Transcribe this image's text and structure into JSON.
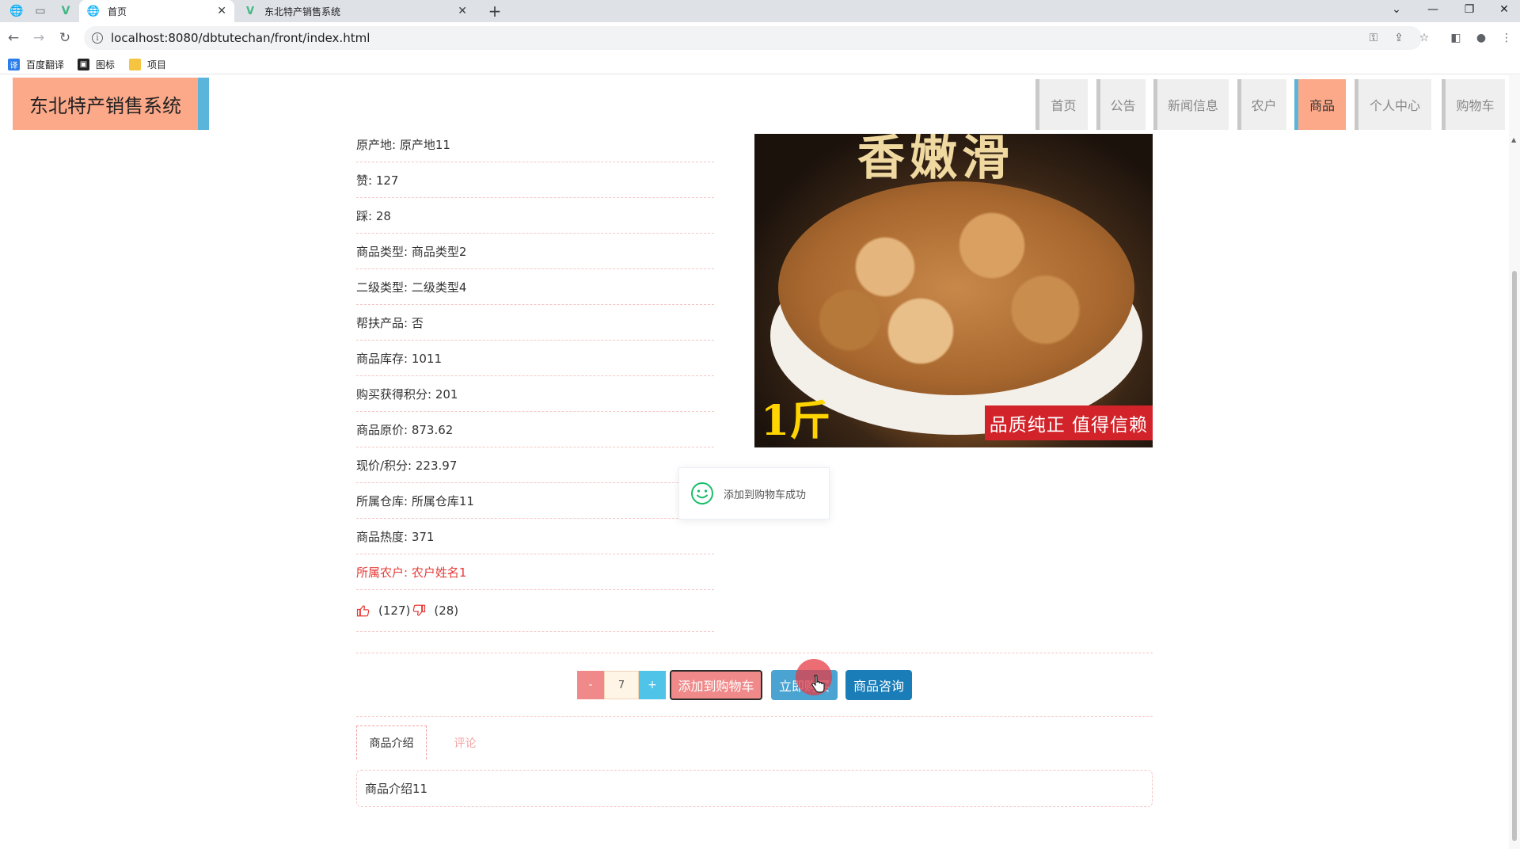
{
  "browser": {
    "tabs": [
      {
        "title": "首页",
        "active": true
      },
      {
        "title": "东北特产销售系统",
        "active": false
      }
    ],
    "url": "localhost:8080/dbtutechan/front/index.html",
    "bookmarks": [
      "百度翻译",
      "图标",
      "项目"
    ]
  },
  "site": {
    "logo": "东北特产销售系统",
    "nav": [
      "首页",
      "公告",
      "新闻信息",
      "农户",
      "商品",
      "个人中心",
      "购物车"
    ],
    "nav_active": "商品"
  },
  "product": {
    "fields": [
      {
        "label": "原产地",
        "value": "原产地11"
      },
      {
        "label": "赞",
        "value": "127"
      },
      {
        "label": "踩",
        "value": "28"
      },
      {
        "label": "商品类型",
        "value": "商品类型2"
      },
      {
        "label": "二级类型",
        "value": "二级类型4"
      },
      {
        "label": "帮扶产品",
        "value": "否"
      },
      {
        "label": "商品库存",
        "value": "1011"
      },
      {
        "label": "购买获得积分",
        "value": "201"
      },
      {
        "label": "商品原价",
        "value": "873.62"
      },
      {
        "label": "现价/积分",
        "value": "223.97"
      },
      {
        "label": "所属仓库",
        "value": "所属仓库11"
      },
      {
        "label": "商品热度",
        "value": "371"
      },
      {
        "label": "所属农户",
        "value": "农户姓名1"
      }
    ],
    "field_lines": [
      "原产地: 原产地11",
      "赞: 127",
      "踩: 28",
      "商品类型: 商品类型2",
      "二级类型: 二级类型4",
      "帮扶产品: 否",
      "商品库存: 1011",
      "购买获得积分: 201",
      "商品原价: 873.62",
      "现价/积分: 223.97",
      "所属仓库: 所属仓库11",
      "商品热度: 371",
      "所属农户: 农户姓名1"
    ],
    "like_text": "(127)",
    "dislike_text": "(28)",
    "image": {
      "title_text": "香嫩滑",
      "weight_text": "1斤",
      "banner_text": "品质纯正 值得信赖"
    },
    "quantity": {
      "minus": "-",
      "value": "7",
      "plus": "+"
    },
    "buttons": {
      "add_to_cart": "添加到购物车",
      "buy_now": "立即购买",
      "consult": "商品咨询"
    },
    "tabs": [
      "商品介绍",
      "评论"
    ],
    "description": "商品介绍11"
  },
  "toast": {
    "message": "添加到购物车成功"
  },
  "colors": {
    "logo_bg": "#fca98a",
    "logo_accent": "#5bb5da",
    "nav_active_bg": "#fca98a",
    "highlight_red": "#e53935",
    "cart_button": "#f08a8a",
    "buy_button": "#4aa3d1",
    "consult_button": "#1a7db8"
  }
}
